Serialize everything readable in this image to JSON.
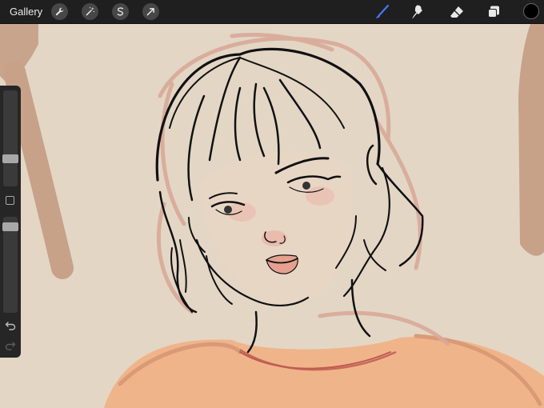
{
  "topbar": {
    "gallery_label": "Gallery",
    "left_tools": [
      "wrench-icon",
      "magic-wand-icon",
      "selection-icon",
      "transform-arrow-icon"
    ],
    "right_tools": [
      "brush-icon",
      "smudge-icon",
      "eraser-icon",
      "layers-icon"
    ],
    "active_tool": "brush-icon",
    "accent_color": "#3d7bff",
    "current_color": "#000000"
  },
  "sidebar": {
    "brush_size_level": 0.33,
    "opacity_level": 0.95,
    "icons": [
      "modify-square-icon",
      "undo-icon",
      "redo-icon"
    ]
  },
  "canvas": {
    "background_color": "#e3d6c5",
    "subject": "line-art-portrait"
  }
}
